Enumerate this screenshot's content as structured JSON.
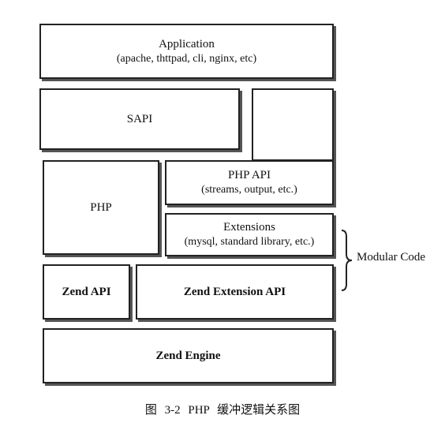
{
  "diagram": {
    "application": {
      "title": "Application",
      "subtitle": "(apache, thttpad, cli, nginx, etc)"
    },
    "sapi": {
      "title": "SAPI"
    },
    "php": {
      "title": "PHP"
    },
    "php_api": {
      "title": "PHP API",
      "subtitle": "(streams, output, etc.)"
    },
    "extensions": {
      "title": "Extensions",
      "subtitle": "(mysql, standard library, etc.)"
    },
    "zend_api": {
      "title": "Zend API"
    },
    "zend_extension_api": {
      "title": "Zend Extension API"
    },
    "zend_engine": {
      "title": "Zend Engine"
    },
    "modular_code_label": "Modular Code"
  },
  "caption": "图 3-2 PHP 缓冲逻辑关系图",
  "colors": {
    "border": "#222222",
    "shadow": "#555555",
    "background": "#ffffff"
  }
}
